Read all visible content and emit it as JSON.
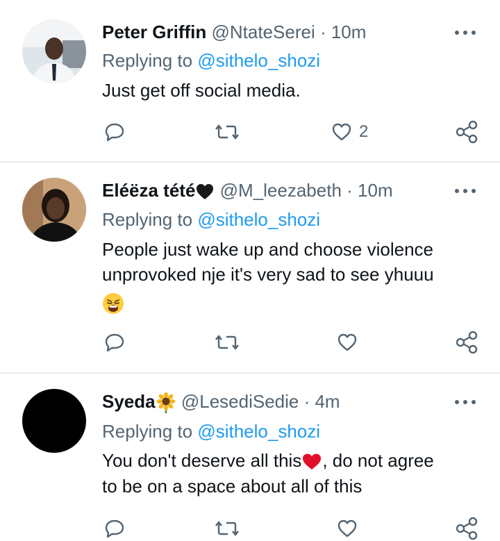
{
  "reply_prefix": "Replying to",
  "tweets": [
    {
      "name": "Peter Griffin",
      "handle": "@NtateSerei",
      "time": "· 10m",
      "replying_to": "@sithelo_shozi",
      "text_lines": [
        "Just get off social media."
      ],
      "likes": "2",
      "avatar": "photo-man-in-car"
    },
    {
      "name": "Eléëza tété",
      "name_emoji": "black-heart-icon",
      "handle": "@M_leezabeth",
      "time": "· 10m",
      "replying_to": "@sithelo_shozi",
      "text_lines": [
        "People just wake up and choose violence",
        "unprovoked nje it's very sad to see yhuuu"
      ],
      "text_emoji": "weary-face-emoji",
      "likes": "",
      "avatar": "photo-woman"
    },
    {
      "name": "Syeda",
      "name_emoji": "sunflower-icon",
      "handle": "@LesediSedie",
      "time": "· 4m",
      "replying_to": "@sithelo_shozi",
      "text_lines": [
        "You don't deserve all this",
        ", do not agree",
        "to be on a space about all of this"
      ],
      "text_emoji": "red-heart-emoji",
      "likes": "",
      "avatar": "black-circle"
    }
  ],
  "colors": {
    "link": "#1d9bf0",
    "meta": "#536471",
    "separator": "#e7ebee",
    "text": "#0f1419"
  }
}
